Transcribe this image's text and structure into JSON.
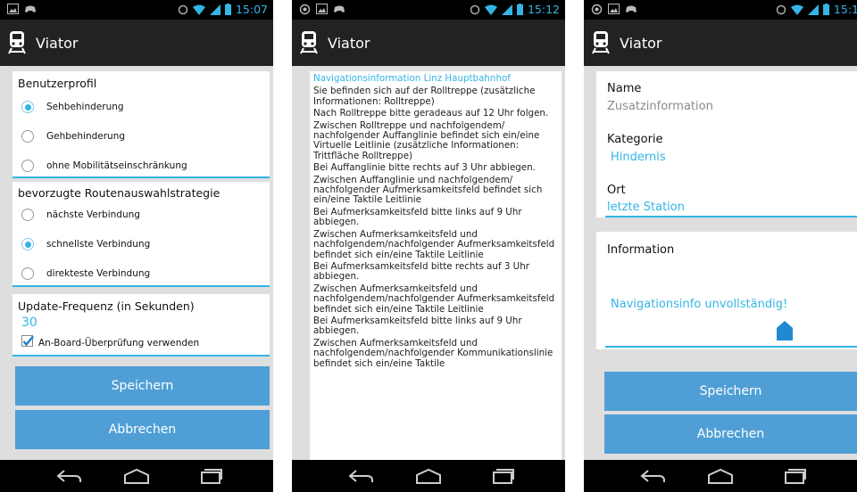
{
  "app": {
    "title": "Viator"
  },
  "screens": [
    {
      "time": "15:07",
      "profile": {
        "label": "Benutzerprofil",
        "options": [
          {
            "label": "Sehbehinderung",
            "selected": true
          },
          {
            "label": "Gehbehinderung",
            "selected": false
          },
          {
            "label": "ohne Mobilitätseinschränkung",
            "selected": false
          }
        ]
      },
      "strategy": {
        "label": "bevorzugte Routenauswahlstrategie",
        "options": [
          {
            "label": "nächste Verbindung",
            "selected": false
          },
          {
            "label": "schnellste Verbindung",
            "selected": true
          },
          {
            "label": "direkteste Verbindung",
            "selected": false
          }
        ]
      },
      "update": {
        "label": "Update-Frequenz (in Sekunden)",
        "value": "30",
        "checkbox_label": "An-Board-Überprüfung verwenden",
        "checked": true
      },
      "save_label": "Speichern",
      "cancel_label": "Abbrechen"
    },
    {
      "time": "15:12",
      "heading": "Navigationsinformation Linz Hauptbahnhof",
      "paragraphs": [
        "Sie befinden sich auf der Rolltreppe (zusätzliche Informationen: Rolltreppe)",
        "Nach Rolltreppe bitte geradeaus auf 12 Uhr folgen.",
        "Zwischen Rolltreppe und nachfolgendem/ nachfolgender Auffanglinie befindet sich ein/eine Virtuelle Leitlinie (zusätzliche Informationen: Trittfläche Rolltreppe)",
        "Bei Auffanglinie bitte rechts auf 3 Uhr abbiegen.",
        "Zwischen Auffanglinie und nachfolgendem/ nachfolgender Aufmerksamkeitsfeld befindet sich ein/eine Taktile Leitlinie",
        "Bei Aufmerksamkeitsfeld bitte links auf 9 Uhr abbiegen.",
        "Zwischen Aufmerksamkeitsfeld und nachfolgendem/nachfolgender Aufmerksamkeitsfeld befindet sich ein/eine Taktile Leitlinie",
        "Bei Aufmerksamkeitsfeld bitte rechts auf 3 Uhr abbiegen.",
        "Zwischen Aufmerksamkeitsfeld und nachfolgendem/nachfolgender Aufmerksamkeitsfeld befindet sich ein/eine Taktile Leitlinie",
        "Bei Aufmerksamkeitsfeld bitte links auf 9 Uhr abbiegen.",
        "Zwischen Aufmerksamkeitsfeld und nachfolgendem/nachfolgender Kommunikationslinie befindet sich ein/eine Taktile"
      ]
    },
    {
      "time": "15:1",
      "name_label": "Name",
      "name_value": "Zusatzinformation",
      "category_label": "Kategorie",
      "category_value": "Hindernis",
      "location_label": "Ort",
      "location_value": "letzte Station",
      "info_label": "Information",
      "info_value": "Navigationsinfo unvollständig!",
      "save_label": "Speichern",
      "cancel_label": "Abbrechen"
    }
  ],
  "colors": {
    "accent": "#33b5e5",
    "button": "#4f9fd6",
    "actionbar": "#222222",
    "background": "#dedede"
  }
}
